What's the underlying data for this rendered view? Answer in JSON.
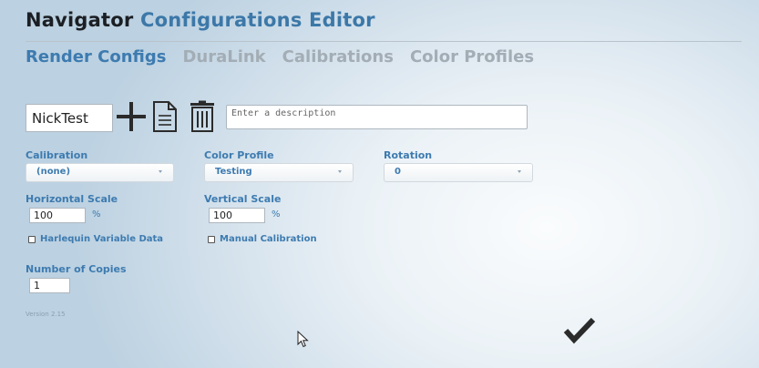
{
  "header": {
    "title_brand": "Navigator",
    "title_rest": "Configurations Editor"
  },
  "tabs": [
    {
      "label": "Render Configs",
      "active": true
    },
    {
      "label": "DuraLink",
      "active": false
    },
    {
      "label": "Calibrations",
      "active": false
    },
    {
      "label": "Color Profiles",
      "active": false
    }
  ],
  "toolbar": {
    "config_name": "NickTest",
    "description_placeholder": "Enter a description",
    "icons": [
      "plus-icon",
      "document-icon",
      "trash-icon"
    ]
  },
  "form": {
    "calibration": {
      "label": "Calibration",
      "value": "(none)"
    },
    "color_profile": {
      "label": "Color Profile",
      "value": "Testing"
    },
    "rotation": {
      "label": "Rotation",
      "value": "0"
    },
    "horizontal_scale": {
      "label": "Horizontal Scale",
      "value": "100",
      "unit": "%"
    },
    "vertical_scale": {
      "label": "Vertical Scale",
      "value": "100",
      "unit": "%"
    },
    "harlequin": {
      "label": "Harlequin Variable Data",
      "checked": false
    },
    "manual_calibration": {
      "label": "Manual Calibration",
      "checked": false
    },
    "copies": {
      "label": "Number of Copies",
      "value": "1"
    }
  },
  "footer": {
    "version": "Version 2.15"
  },
  "colors": {
    "accent": "#3d7bb0",
    "title_dark": "#1b1f24",
    "tab_inactive": "#a3adb5",
    "icon_dark": "#2b2b2b"
  }
}
